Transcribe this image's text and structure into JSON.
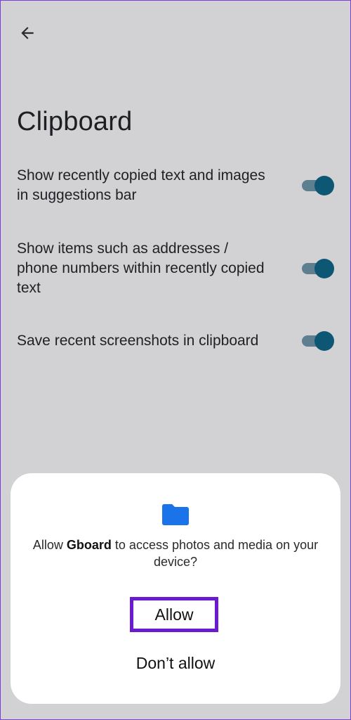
{
  "screen": {
    "title": "Clipboard",
    "back_icon": "arrow-left-icon"
  },
  "settings": [
    {
      "label": "Show recently copied text and images in suggestions bar",
      "enabled": true
    },
    {
      "label": "Show items such as addresses / phone numbers within recently copied text",
      "enabled": true
    },
    {
      "label": "Save recent screenshots in clipboard",
      "enabled": true
    }
  ],
  "dialog": {
    "icon": "folder-icon",
    "prompt_prefix": "Allow ",
    "app_name": "Gboard",
    "prompt_suffix": " to access photos and media on your device?",
    "allow_label": "Allow",
    "deny_label": "Don’t allow"
  },
  "colors": {
    "background": "#d2d2d4",
    "toggle_thumb": "#0d5674",
    "toggle_track": "#5d7f8f",
    "folder_icon": "#1a73e8",
    "highlight_border": "#6a1bd1"
  }
}
